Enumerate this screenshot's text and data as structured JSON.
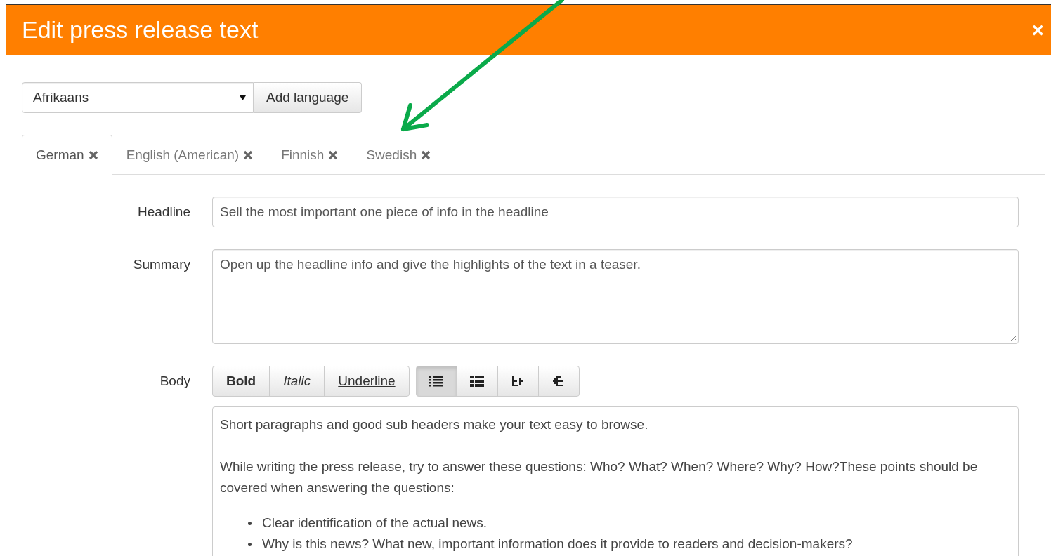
{
  "dialog": {
    "title": "Edit press release text",
    "close": "×"
  },
  "language_picker": {
    "value": "Afrikaans",
    "add_button": "Add language"
  },
  "tabs": [
    {
      "label": "German",
      "selected": true
    },
    {
      "label": "English (American)",
      "selected": false
    },
    {
      "label": "Finnish",
      "selected": false
    },
    {
      "label": "Swedish",
      "selected": false
    }
  ],
  "fields": [
    {
      "label": "Headline",
      "kind": "line",
      "value": "Sell the most important one piece of info in the headline"
    },
    {
      "label": "Summary",
      "kind": "area",
      "value": "Open up the headline info and give the highlights of the text in a teaser."
    }
  ],
  "body": {
    "label": "Body",
    "format_buttons": [
      {
        "label": "Bold",
        "kind": "bold",
        "active": false
      },
      {
        "label": "Italic",
        "kind": "italic",
        "active": false
      },
      {
        "label": "Underline",
        "kind": "underline",
        "active": false
      }
    ],
    "list_buttons": [
      {
        "kind": "bullets",
        "active": true
      },
      {
        "kind": "numbers",
        "active": false
      },
      {
        "kind": "outdent",
        "active": false
      },
      {
        "kind": "indent",
        "active": false
      }
    ],
    "paragraphs": [
      "Short paragraphs and good sub headers make your text easy to browse.",
      "While writing the press release, try to answer these questions: Who? What? When? Where? Why? How?These points should be covered when answering the questions:"
    ],
    "bullets": [
      "Clear identification of the actual news.",
      "Why is this news? What new, important information does it provide to readers and decision-makers?"
    ]
  }
}
